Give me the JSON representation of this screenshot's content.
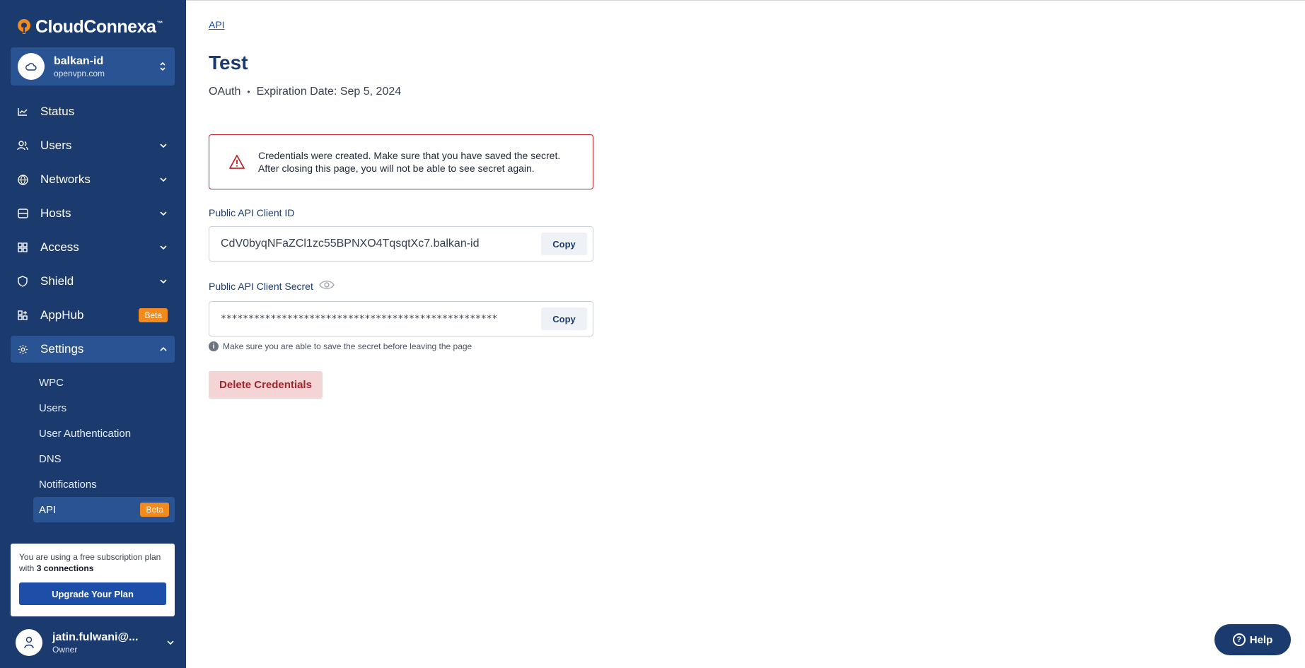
{
  "brand": {
    "name": "CloudConnexa",
    "tm": "™",
    "accent": "#f28a1e",
    "sidebar_bg": "#1b3b6f"
  },
  "org": {
    "name": "balkan-id",
    "domain": "openvpn.com"
  },
  "nav": {
    "items": [
      {
        "label": "Status",
        "icon": "chart-line-icon"
      },
      {
        "label": "Users",
        "icon": "users-icon"
      },
      {
        "label": "Networks",
        "icon": "globe-icon"
      },
      {
        "label": "Hosts",
        "icon": "server-icon"
      },
      {
        "label": "Access",
        "icon": "grid-icon"
      },
      {
        "label": "Shield",
        "icon": "shield-icon"
      },
      {
        "label": "AppHub",
        "icon": "apps-icon",
        "badge": "Beta"
      },
      {
        "label": "Settings",
        "icon": "gear-icon"
      }
    ],
    "settings_sub": [
      {
        "label": "WPC"
      },
      {
        "label": "Users"
      },
      {
        "label": "User Authentication"
      },
      {
        "label": "DNS"
      },
      {
        "label": "Notifications"
      },
      {
        "label": "API",
        "badge": "Beta"
      }
    ]
  },
  "plan": {
    "text_prefix": "You are using a free subscription plan with ",
    "connections": "3 connections",
    "upgrade_label": "Upgrade Your Plan"
  },
  "user": {
    "name": "jatin.fulwani@...",
    "role": "Owner"
  },
  "main": {
    "breadcrumb": "API",
    "title": "Test",
    "auth_type": "OAuth",
    "separator": "•",
    "expiration": "Expiration Date: Sep 5, 2024",
    "alert_line1": "Credentials were created. Make sure that you have saved the secret.",
    "alert_line2": "After closing this page, you will not be able to see secret again.",
    "client_id_label": "Public API Client ID",
    "client_id_value": "CdV0byqNFaZCl1zc55BPNXO4TqsqtXc7.balkan-id",
    "secret_label": "Public API Client Secret",
    "secret_value": "**************************************************",
    "copy_label": "Copy",
    "hint": "Make sure you are able to save the secret before leaving the page",
    "delete_label": "Delete Credentials"
  },
  "help": {
    "label": "Help"
  }
}
